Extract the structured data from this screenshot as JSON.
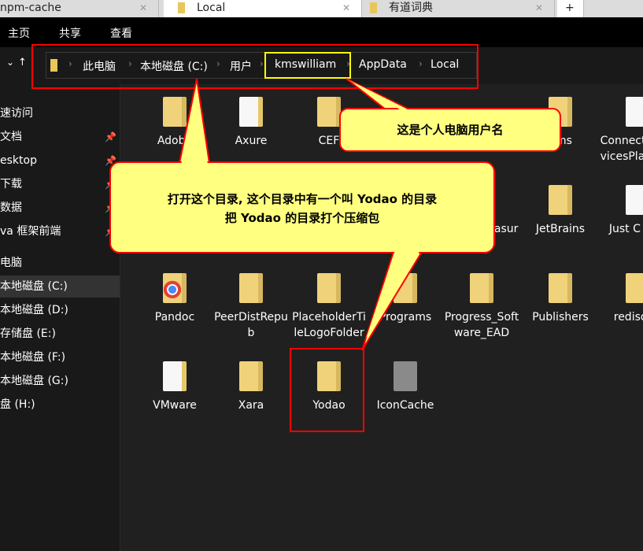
{
  "tabs": [
    {
      "label": "npm-cache"
    },
    {
      "label": "Local",
      "active": true
    },
    {
      "label": "有道词典"
    }
  ],
  "ribbon": [
    "主页",
    "共享",
    "查看"
  ],
  "breadcrumb": [
    "此电脑",
    "本地磁盘 (C:)",
    "用户",
    "kmswilliam",
    "AppData",
    "Local"
  ],
  "sidebar": [
    {
      "label": "速访问"
    },
    {
      "label": "文档",
      "pinned": true
    },
    {
      "label": "esktop",
      "pinned": true
    },
    {
      "label": "下载",
      "pinned": true
    },
    {
      "label": "数据",
      "pinned": true
    },
    {
      "label": "va 框架前端",
      "pinned": true
    },
    {
      "label": "电脑"
    },
    {
      "label": "本地磁盘 (C:)",
      "selected": true
    },
    {
      "label": "本地磁盘 (D:)"
    },
    {
      "label": "存储盘 (E:)"
    },
    {
      "label": "本地磁盘 (F:)"
    },
    {
      "label": "本地磁盘 (G:)"
    },
    {
      "label": "盘 (H:)"
    }
  ],
  "files": [
    {
      "name": "Adobe",
      "icon": "folder"
    },
    {
      "name": "Axure",
      "icon": "folder-doc"
    },
    {
      "name": "CEF",
      "icon": "folder"
    },
    {
      "name": "nms",
      "icon": "folder"
    },
    {
      "name": "ConnectedDevicesPlatform",
      "icon": "folder-doc"
    },
    {
      "name": "u_A _Ja yasur",
      "icon": "folder"
    },
    {
      "name": "JetBrains",
      "icon": "folder"
    },
    {
      "name": "Just C Pick",
      "icon": "folder-doc"
    },
    {
      "name": "Pandoc",
      "icon": "chrome"
    },
    {
      "name": "PeerDistRepub",
      "icon": "folder"
    },
    {
      "name": "PlaceholderTileLogoFolder",
      "icon": "folder"
    },
    {
      "name": "Programs",
      "icon": "folder"
    },
    {
      "name": "Progress_Software_EAD",
      "icon": "folder"
    },
    {
      "name": "Publishers",
      "icon": "folder"
    },
    {
      "name": "redisdop",
      "icon": "folder"
    },
    {
      "name": "VMware",
      "icon": "folder-doc"
    },
    {
      "name": "Xara",
      "icon": "folder"
    },
    {
      "name": "Yodao",
      "icon": "folder"
    },
    {
      "name": "IconCache",
      "icon": "gear-file"
    }
  ],
  "callouts": {
    "username": "这是个人电脑用户名",
    "instruction_line1": "打开这个目录, 这个目录中有一个叫 Yodao 的目录",
    "instruction_line2": "把 Yodao 的目录打个压缩包"
  },
  "colors": {
    "callout_fill": "#ffff80",
    "annotation_red": "#ff0000",
    "highlight_yellow": "#ffff00"
  }
}
